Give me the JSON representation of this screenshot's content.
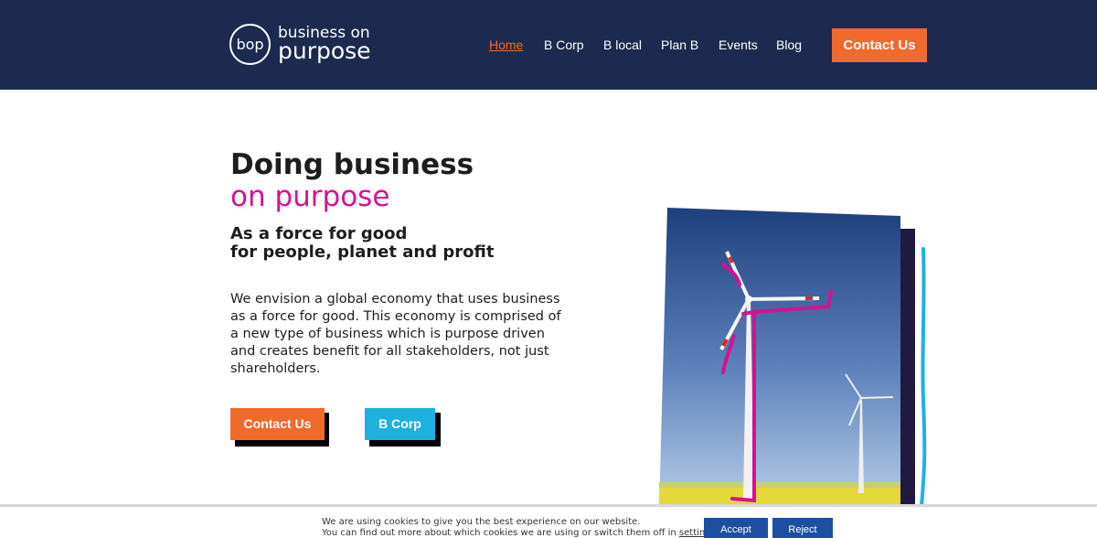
{
  "header": {
    "logo": {
      "mark": "bop",
      "line1": "business on",
      "line2": "purpose"
    },
    "nav": [
      {
        "label": "Home",
        "active": true
      },
      {
        "label": "B Corp",
        "active": false
      },
      {
        "label": "B local",
        "active": false
      },
      {
        "label": "Plan B",
        "active": false
      },
      {
        "label": "Events",
        "active": false
      },
      {
        "label": "Blog",
        "active": false
      }
    ],
    "contact_button": "Contact Us"
  },
  "hero": {
    "title_line1": "Doing business",
    "title_line2": "on purpose",
    "subtitle_line1": "As a force for good",
    "subtitle_line2": "for people, planet and profit",
    "body": "We envision a global economy that uses business as a force for good. This economy is comprised of a new type of business which is purpose driven and creates benefit for all stakeholders, not just shareholders.",
    "buttons": [
      {
        "label": "Contact Us",
        "color": "#f26a2b"
      },
      {
        "label": "B Corp",
        "color": "#1eb1dd"
      }
    ],
    "image": {
      "icon": "wind-turbines-photo"
    }
  },
  "cookie_bar": {
    "line1": "We are using cookies to give you the best experience on our website.",
    "line2_prefix": "You can find out more about which cookies we are using or switch them off in ",
    "settings_link": "settings",
    "line2_suffix": ".",
    "accept": "Accept",
    "reject": "Reject"
  },
  "colors": {
    "header_bg": "#1b2a4e",
    "accent_orange": "#f26a2b",
    "accent_magenta": "#d5118f",
    "accent_blue": "#1eb1dd",
    "cookie_button": "#1c4fa0"
  }
}
